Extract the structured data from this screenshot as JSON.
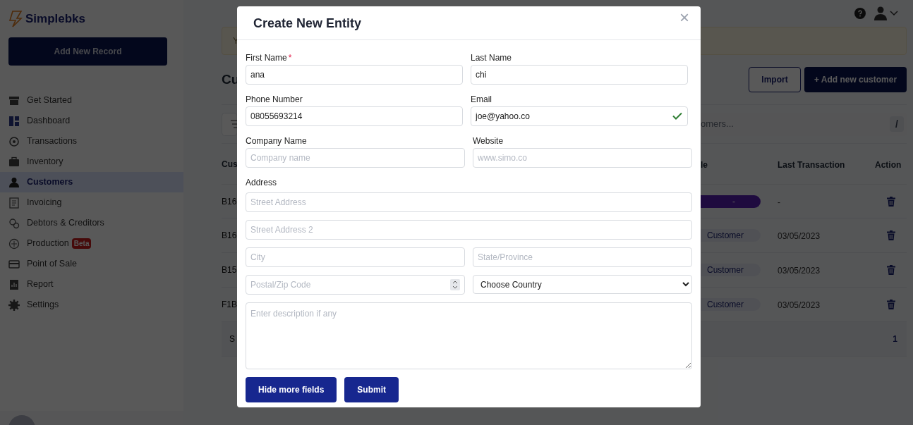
{
  "sidebar": {
    "logo": "Simplebks",
    "add_button": "Add New Record",
    "items": [
      {
        "label": "Get Started",
        "selected": false
      },
      {
        "label": "Dashboard",
        "selected": false
      },
      {
        "label": "Transactions",
        "selected": false
      },
      {
        "label": "Inventory",
        "selected": false
      },
      {
        "label": "Customers",
        "selected": true
      },
      {
        "label": "Invoicing",
        "selected": false
      },
      {
        "label": "Debtors & Creditors",
        "selected": false
      },
      {
        "label": "Production",
        "selected": false,
        "badge": "Beta"
      },
      {
        "label": "Point of Sale",
        "selected": false
      },
      {
        "label": "Report",
        "selected": false
      },
      {
        "label": "Settings",
        "selected": false
      }
    ]
  },
  "banner": {
    "text": "Y"
  },
  "page": {
    "title": "Cu",
    "import_button": "Import",
    "add_button": "+ Add new customer",
    "search_placeholder": "omers...",
    "search_key": "/"
  },
  "table": {
    "columns": [
      "Cus",
      "le",
      "Last Transaction",
      "Action"
    ],
    "rows": [
      {
        "id": "B16",
        "type": "-",
        "kind": "empty",
        "last_transaction": "-"
      },
      {
        "id": "B16",
        "type": "Customer",
        "kind": "customer",
        "last_transaction": "03/05/2023"
      },
      {
        "id": "B15",
        "type": "Customer",
        "kind": "customer",
        "last_transaction": "03/05/2023"
      },
      {
        "id": "F1B",
        "type": "Customer",
        "kind": "customer",
        "last_transaction": "03/05/2023"
      }
    ],
    "footer": "S",
    "page_number": "1"
  },
  "modal": {
    "title": "Create New Entity",
    "close": "×",
    "rows": [
      {
        "fields": [
          {
            "kind": "text",
            "label": "First Name",
            "required_mark": "*",
            "value": "ana"
          },
          {
            "kind": "text",
            "label": "Last Name",
            "value": "chi"
          }
        ]
      },
      {
        "fields": [
          {
            "kind": "text",
            "label": "Phone Number",
            "value": "08055693214"
          },
          {
            "kind": "text",
            "label": "Email",
            "value": "joe@yahoo.co",
            "valid": true
          }
        ]
      },
      {
        "fields": [
          {
            "kind": "text",
            "label": "Company Name",
            "placeholder": "Company name"
          },
          {
            "kind": "text",
            "label": "Website",
            "placeholder": "www.simo.co"
          }
        ]
      },
      {
        "label": "Address",
        "fields": [
          {
            "kind": "text",
            "placeholder": "Street Address"
          }
        ]
      },
      {
        "fields": [
          {
            "kind": "text",
            "placeholder": "Street Address 2"
          }
        ]
      },
      {
        "fields": [
          {
            "kind": "text",
            "placeholder": "City"
          },
          {
            "kind": "text",
            "placeholder": "State/Province"
          }
        ]
      },
      {
        "fields": [
          {
            "kind": "number",
            "placeholder": "Postal/Zip Code"
          },
          {
            "kind": "select",
            "value": "Choose Country"
          }
        ]
      },
      {
        "fields": [
          {
            "kind": "textarea",
            "placeholder": "Enter description if any"
          }
        ]
      }
    ],
    "buttons": [
      "Hide more fields",
      "Submit"
    ]
  }
}
